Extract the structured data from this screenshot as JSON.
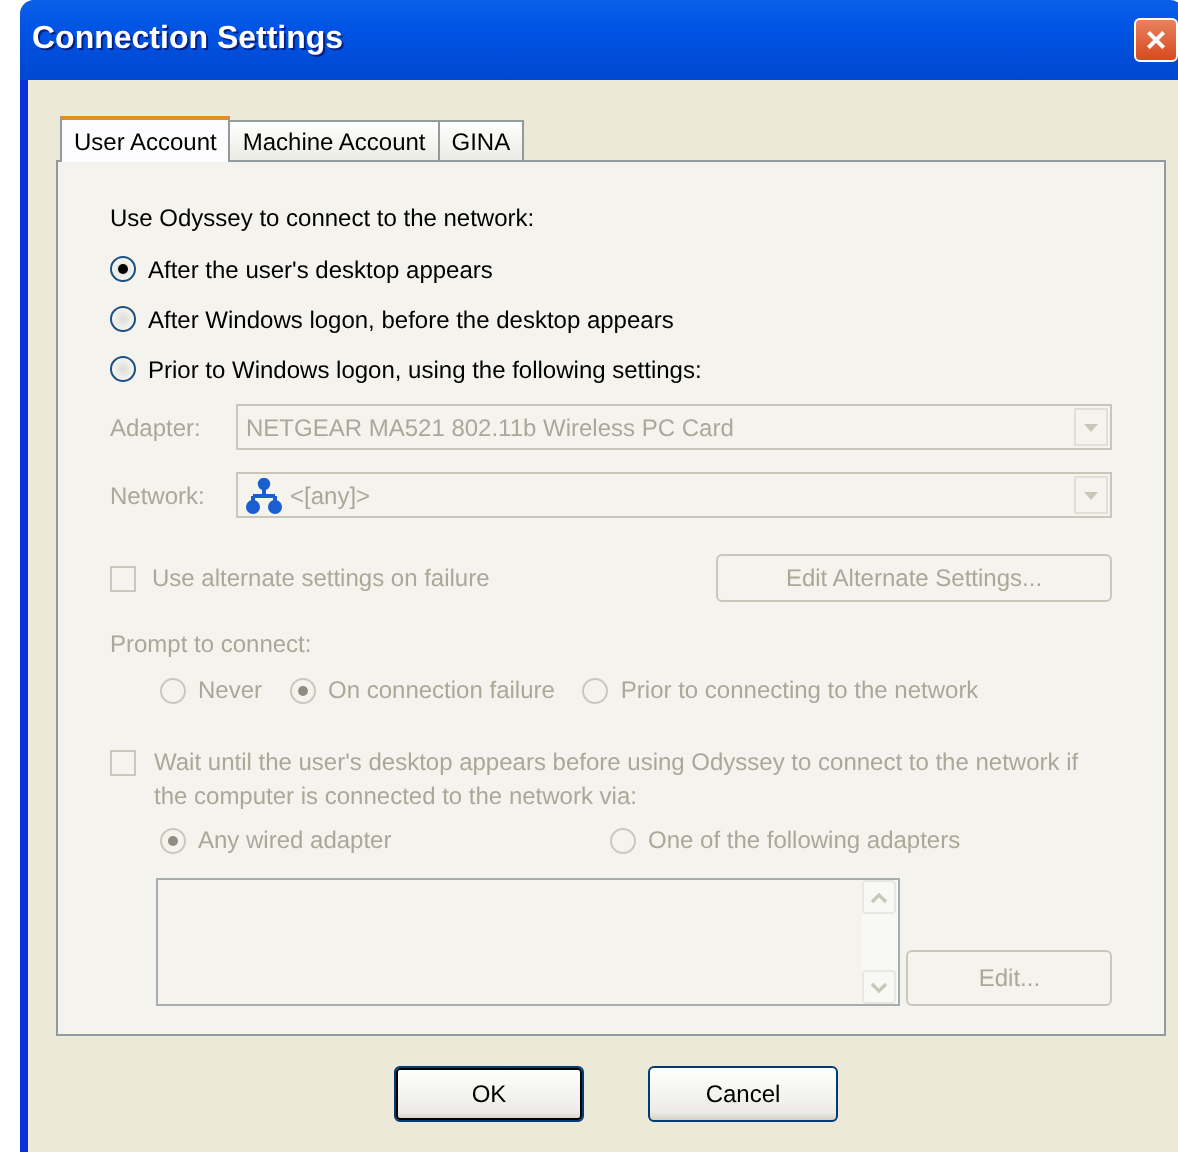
{
  "window": {
    "title": "Connection Settings",
    "close": "×"
  },
  "tabs": [
    {
      "label": "User Account",
      "selected": true
    },
    {
      "label": "Machine Account",
      "selected": false
    },
    {
      "label": "GINA",
      "selected": false
    }
  ],
  "panel": {
    "heading": "Use Odyssey to connect to the network:",
    "start_options": [
      {
        "label": "After the user's desktop appears",
        "selected": true
      },
      {
        "label": "After Windows logon, before the desktop appears",
        "selected": false
      },
      {
        "label": "Prior to Windows logon, using the following settings:",
        "selected": false
      }
    ],
    "logon_settings": {
      "disabled": true,
      "adapter": {
        "label": "Adapter:",
        "value": "NETGEAR MA521 802.11b Wireless PC Card"
      },
      "network": {
        "label": "Network:",
        "value": "<[any]>"
      },
      "alternate": {
        "label": "Use alternate settings on failure",
        "checked": false,
        "button": "Edit Alternate Settings..."
      },
      "prompt": {
        "label": "Prompt to connect:",
        "options": [
          {
            "label": "Never",
            "selected": false
          },
          {
            "label": "On connection failure",
            "selected": true
          },
          {
            "label": "Prior to connecting to the network",
            "selected": false
          }
        ]
      },
      "wait": {
        "label": "Wait until the user's desktop appears before using Odyssey to connect to the network if the computer is connected to the network via:",
        "checked": false,
        "options": [
          {
            "label": "Any wired adapter",
            "selected": true
          },
          {
            "label": "One of the following adapters",
            "selected": false
          }
        ],
        "edit_button": "Edit..."
      }
    }
  },
  "buttons": [
    {
      "label": "OK",
      "default": true
    },
    {
      "label": "Cancel",
      "default": false
    }
  ]
}
